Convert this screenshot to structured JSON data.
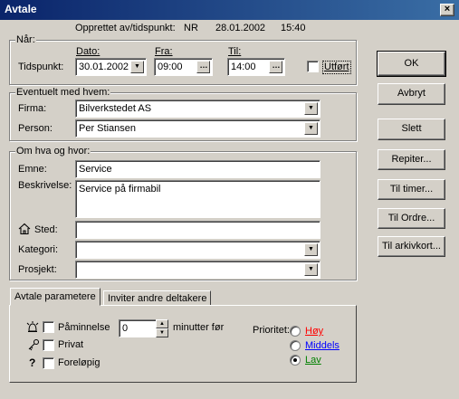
{
  "window": {
    "title": "Avtale",
    "close_icon": "×"
  },
  "created": {
    "label": "Opprettet av/tidspunkt:",
    "by": "NR",
    "date": "28.01.2002",
    "time": "15:40"
  },
  "naar": {
    "legend": "Når:",
    "date_label": "Dato:",
    "from_label": "Fra:",
    "to_label": "Til:",
    "row_label": "Tidspunkt:",
    "date_value": "30.01.2002",
    "from_value": "09:00",
    "to_value": "14:00",
    "ellipsis": "…",
    "done_label": "Utført",
    "done_checked": false
  },
  "with": {
    "legend": "Eventuelt med hvem:",
    "company_label": "Firma:",
    "company_value": "Bilverkstedet AS",
    "person_label": "Person:",
    "person_value": "Per Stiansen"
  },
  "about": {
    "legend": "Om hva og hvor:",
    "subject_label": "Emne:",
    "subject_value": "Service",
    "desc_label": "Beskrivelse:",
    "desc_value": "Service på firmabil",
    "place_label": "Sted:",
    "place_value": "",
    "category_label": "Kategori:",
    "category_value": "",
    "project_label": "Prosjekt:",
    "project_value": ""
  },
  "buttons": {
    "ok": "OK",
    "cancel": "Avbryt",
    "delete": "Slett",
    "repeat": "Repiter...",
    "to_timer": "Til timer...",
    "to_order": "Til Ordre...",
    "to_archive": "Til arkivkort..."
  },
  "tabs": {
    "params": "Avtale parametere",
    "invite": "Inviter andre deltakere"
  },
  "params": {
    "reminder_label": "Påminnelse",
    "reminder_value": "0",
    "reminder_suffix": "minutter før",
    "private_label": "Privat",
    "preliminary_label": "Foreløpig",
    "priority_label": "Prioritet:",
    "priority_high": "Høy",
    "priority_medium": "Middels",
    "priority_low": "Lav",
    "priority_selected": "Lav",
    "question_glyph": "?"
  },
  "colors": {
    "high": "#ff0000",
    "medium": "#0000ff",
    "low": "#008000"
  }
}
